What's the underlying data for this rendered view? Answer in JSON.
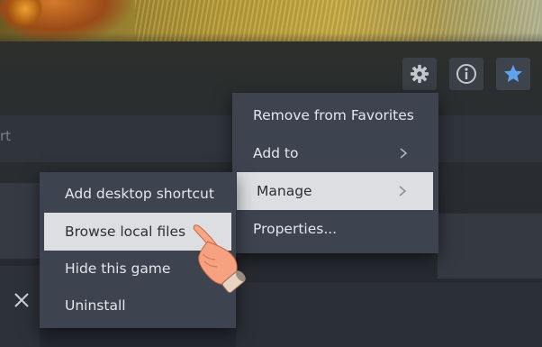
{
  "toolbar": {
    "settings_icon": "gear-icon",
    "info_icon": "info-icon",
    "favorite_icon": "star-icon",
    "favorite_color": "#5fa3ee"
  },
  "search_row": {
    "partial_text": "rt"
  },
  "context_menu": {
    "items": [
      {
        "label": "Remove from Favorites",
        "has_submenu": false
      },
      {
        "label": "Add to",
        "has_submenu": true
      },
      {
        "label": "Manage",
        "has_submenu": true,
        "highlighted": true
      },
      {
        "label": "Properties...",
        "has_submenu": false
      }
    ]
  },
  "manage_submenu": {
    "items": [
      {
        "label": "Add desktop shortcut"
      },
      {
        "label": "Browse local files",
        "highlighted": true
      },
      {
        "label": "Hide this game"
      },
      {
        "label": "Uninstall"
      }
    ]
  },
  "colors": {
    "menu_bg": "#3d4450",
    "highlight_bg": "#dcdee2",
    "text": "#e4e6ea"
  }
}
